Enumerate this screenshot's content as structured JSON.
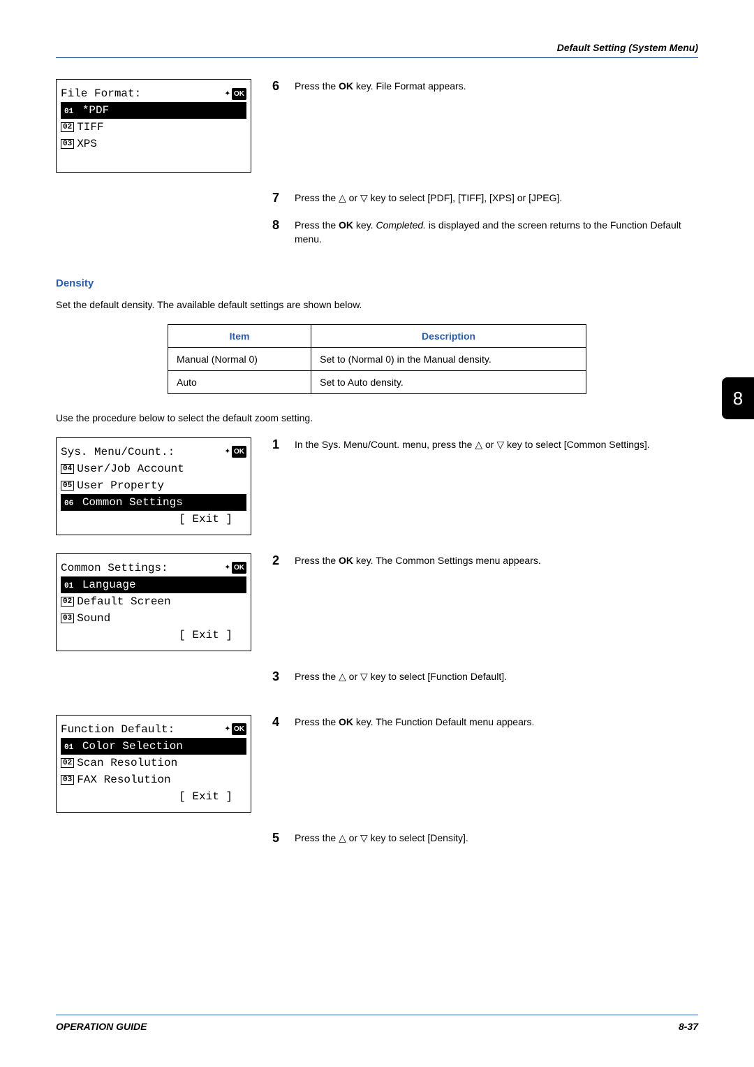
{
  "header": {
    "title": "Default Setting (System Menu)"
  },
  "chapter_tab": "8",
  "footer": {
    "left": "OPERATION GUIDE",
    "right": "8-37"
  },
  "lcd1": {
    "title": "File Format:",
    "item1_num": "01",
    "item1_text": "*PDF",
    "item2_num": "02",
    "item2_text": "TIFF",
    "item3_num": "03",
    "item3_text": "XPS"
  },
  "step6": {
    "num": "6",
    "text_a": "Press the ",
    "bold": "OK",
    "text_b": " key. File Format appears."
  },
  "step7": {
    "num": "7",
    "text": "Press the △ or ▽ key to select [PDF], [TIFF], [XPS] or [JPEG]."
  },
  "step8": {
    "num": "8",
    "text_a": "Press the ",
    "bold1": "OK",
    "text_b": " key. ",
    "italic": "Completed.",
    "text_c": " is displayed and the screen returns to the Function Default menu."
  },
  "density_heading": "Density",
  "density_intro": "Set the default density. The available default settings are shown below.",
  "table": {
    "h1": "Item",
    "h2": "Description",
    "r1c1": "Manual (Normal 0)",
    "r1c2": "Set to (Normal 0) in the Manual density.",
    "r2c1": "Auto",
    "r2c2": "Set to Auto density."
  },
  "zoom_intro": "Use the procedure below to select the default zoom setting.",
  "lcd2": {
    "title": "Sys. Menu/Count.:",
    "item1_num": "04",
    "item1_text": "User/Job Account",
    "item2_num": "05",
    "item2_text": "User Property",
    "item3_num": "06",
    "item3_text": "Common Settings",
    "exit": "[  Exit   ]"
  },
  "lcd3": {
    "title": "Common Settings:",
    "item1_num": "01",
    "item1_text": "Language",
    "item2_num": "02",
    "item2_text": "Default Screen",
    "item3_num": "03",
    "item3_text": "Sound",
    "exit": "[  Exit   ]"
  },
  "lcd4": {
    "title": "Function Default:",
    "item1_num": "01",
    "item1_text": "Color Selection",
    "item2_num": "02",
    "item2_text": "Scan Resolution",
    "item3_num": "03",
    "item3_text": "FAX Resolution",
    "exit": "[  Exit   ]"
  },
  "step1": {
    "num": "1",
    "text": "In the Sys. Menu/Count. menu, press the △ or ▽ key to select [Common Settings]."
  },
  "step2": {
    "num": "2",
    "text_a": "Press the ",
    "bold": "OK",
    "text_b": " key. The Common Settings menu appears."
  },
  "step3": {
    "num": "3",
    "text": "Press the △ or ▽ key to select [Function Default]."
  },
  "step4": {
    "num": "4",
    "text_a": "Press the ",
    "bold": "OK",
    "text_b": " key. The Function Default menu appears."
  },
  "step5": {
    "num": "5",
    "text": "Press the △ or ▽ key to select [Density]."
  }
}
